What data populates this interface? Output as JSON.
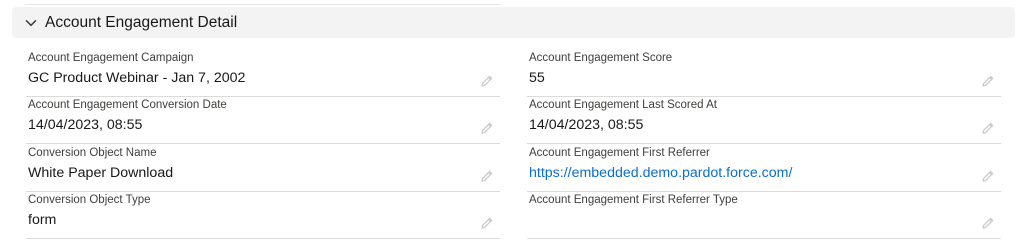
{
  "section": {
    "title": "Account Engagement Detail",
    "expanded": true,
    "icon": "chevron-down-icon"
  },
  "edit_icon": "pencil-icon",
  "colors": {
    "header_bg": "#f3f3f3",
    "link": "#0b6ecf",
    "divider": "#dddbda",
    "label": "#3e3e3c"
  },
  "fields": {
    "campaign": {
      "label": "Account Engagement Campaign",
      "value": "GC Product Webinar - Jan 7, 2002"
    },
    "score": {
      "label": "Account Engagement Score",
      "value": "55"
    },
    "conversion_date": {
      "label": "Account Engagement Conversion Date",
      "value": "14/04/2023, 08:55"
    },
    "last_scored_at": {
      "label": "Account Engagement Last Scored At",
      "value": "14/04/2023, 08:55"
    },
    "conversion_object_name": {
      "label": "Conversion Object Name",
      "value": "White Paper Download"
    },
    "first_referrer": {
      "label": "Account Engagement First Referrer",
      "value": "https://embedded.demo.pardot.force.com/"
    },
    "conversion_object_type": {
      "label": "Conversion Object Type",
      "value": "form"
    },
    "first_referrer_type": {
      "label": "Account Engagement First Referrer Type",
      "value": ""
    }
  }
}
